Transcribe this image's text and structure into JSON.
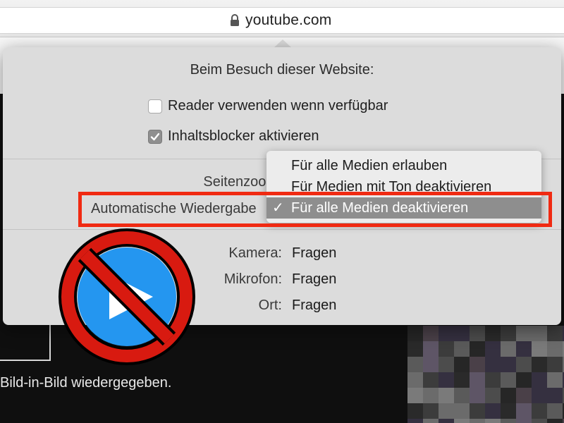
{
  "browser": {
    "url": "youtube.com",
    "lock_icon": "lock-icon"
  },
  "popover": {
    "title": "Beim Besuch dieser Website:",
    "reader": {
      "label": "Reader verwenden wenn verfügbar",
      "checked": false
    },
    "content_blocker": {
      "label": "Inhaltsblocker aktivieren",
      "checked": true
    },
    "page_zoom_label": "Seitenzoom",
    "autoplay_label": "Automatische Wiedergabe",
    "autoplay_menu": {
      "options": [
        {
          "label": "Für alle Medien erlauben",
          "selected": false
        },
        {
          "label": "Für Medien mit Ton deaktivieren",
          "selected": false
        },
        {
          "label": "Für alle Medien deaktivieren",
          "selected": true
        }
      ],
      "check_mark": "✓"
    },
    "permissions": [
      {
        "label": "Kamera:",
        "value": "Fragen"
      },
      {
        "label": "Mikrofon:",
        "value": "Fragen"
      },
      {
        "label": "Ort:",
        "value": "Fragen"
      }
    ]
  },
  "page": {
    "caption": "Bild-in-Bild wiedergegeben."
  },
  "overlay": {
    "highlight_color": "#f02a12",
    "sign_icon": "no-autoplay-icon",
    "sign_ring_color": "#d81a10",
    "play_circle_color": "#2496f0"
  }
}
